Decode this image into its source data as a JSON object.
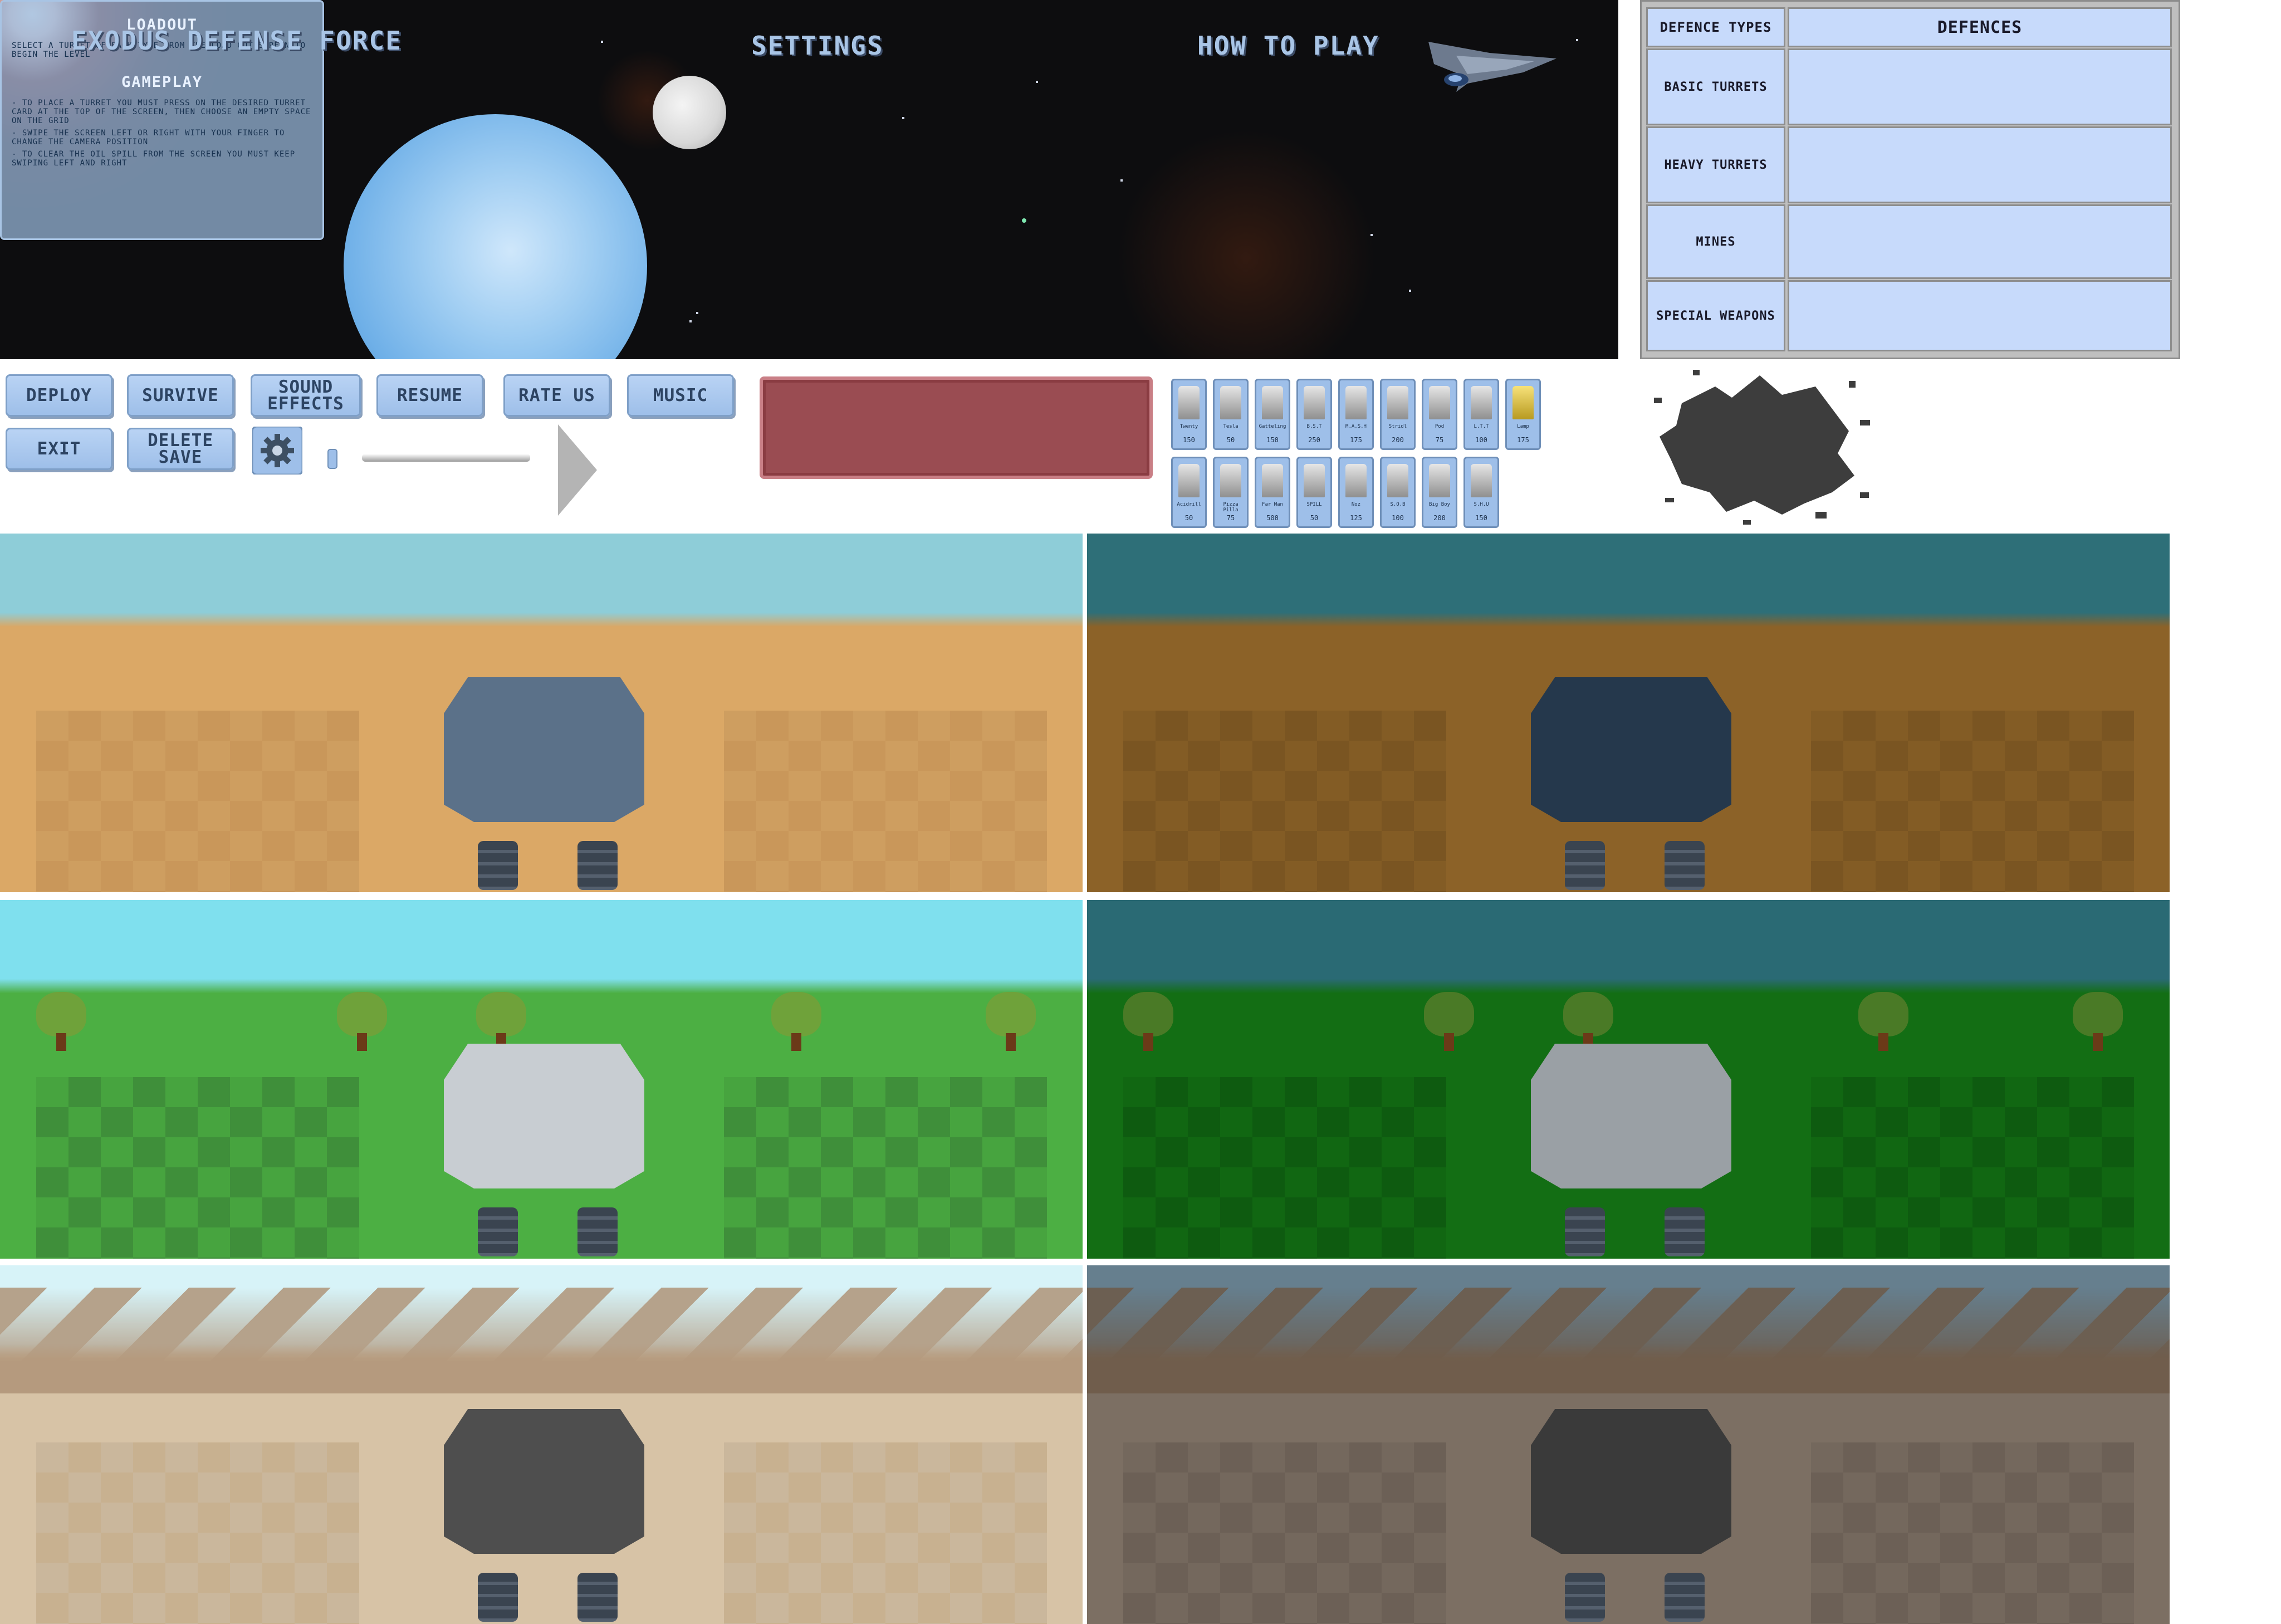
{
  "title_screen": {
    "game_title": "EXODUS DEFENSE FORCE",
    "settings_label": "SETTINGS",
    "how_to_play_label": "HOW TO PLAY",
    "howto_panel": {
      "heading_1": "LOADOUT",
      "text_1": "SELECT A TURRET OF EACH TYPE FROM THE LOAD OUT SCREEN TO BEGIN THE LEVEL",
      "heading_2": "GAMEPLAY",
      "text_2": "- TO PLACE A TURRET YOU MUST PRESS ON THE DESIRED TURRET CARD AT THE TOP OF THE SCREEN, THEN CHOOSE AN EMPTY SPACE ON THE GRID",
      "text_3": "- SWIPE THE SCREEN LEFT OR RIGHT WITH YOUR FINGER TO CHANGE THE CAMERA POSITION",
      "text_4": "- TO CLEAR THE OIL SPILL FROM THE SCREEN YOU MUST KEEP SWIPING LEFT AND RIGHT"
    }
  },
  "defence_table": {
    "header_left": "DEFENCE TYPES",
    "header_right": "DEFENCES",
    "rows": [
      "BASIC TURRETS",
      "HEAVY TURRETS",
      "MINES",
      "SPECIAL WEAPONS"
    ]
  },
  "buttons": {
    "deploy": "DEPLOY",
    "survive": "SURVIVE",
    "sound_effects_1": "SOUND",
    "sound_effects_2": "EFFECTS",
    "resume": "RESUME",
    "rate_us": "RATE US",
    "music": "MUSIC",
    "exit": "EXIT",
    "delete_save_1": "DELETE",
    "delete_save_2": "SAVE"
  },
  "music_slider": {
    "level": 0.0
  },
  "cards": [
    {
      "name": "Twenty",
      "cost": "150"
    },
    {
      "name": "Tesla",
      "cost": "50"
    },
    {
      "name": "Gatteling",
      "cost": "150"
    },
    {
      "name": "B.S.T",
      "cost": "250"
    },
    {
      "name": "M.A.S.H",
      "cost": "175"
    },
    {
      "name": "Stridl",
      "cost": "200"
    },
    {
      "name": "Pod",
      "cost": "75"
    },
    {
      "name": "L.T.T",
      "cost": "100"
    },
    {
      "name": "Lamp",
      "cost": "175"
    },
    {
      "name": "Acidrill",
      "cost": "50"
    },
    {
      "name": "Pizza Pilla",
      "cost": "75"
    },
    {
      "name": "Far Man",
      "cost": "500"
    },
    {
      "name": "SPILL",
      "cost": "50"
    },
    {
      "name": "Noz",
      "cost": "125"
    },
    {
      "name": "S.O.B",
      "cost": "100"
    },
    {
      "name": "Big Boy",
      "cost": "200"
    },
    {
      "name": "S.H.U",
      "cost": "150"
    }
  ],
  "colors": {
    "button_fill": "#9ebfe9",
    "button_text": "#2d4463",
    "title_text": "#a9c5e6",
    "table_cell": "#c7dafb",
    "textbox": "#9a4c52"
  },
  "levels": [
    {
      "name": "desert-day",
      "sky": "#8ecdd8",
      "ground": "#dba866",
      "grid": "#c9975a"
    },
    {
      "name": "desert-night",
      "sky": "#2e6f78",
      "ground": "#8c6228",
      "grid": "#7a5522"
    },
    {
      "name": "grass-day",
      "sky": "#7fe0ee",
      "ground": "#4caf43",
      "grid": "#3f8f3a"
    },
    {
      "name": "grass-night",
      "sky": "#2a6a74",
      "ground": "#136e14",
      "grid": "#0e5b10"
    },
    {
      "name": "mountain-day",
      "sky": "#d7f3f8",
      "ground": "#d7c3a6",
      "grid": "#c8b190"
    },
    {
      "name": "mountain-night",
      "sky": "#667f8e",
      "ground": "#7c6f63",
      "grid": "#6c6056"
    }
  ]
}
